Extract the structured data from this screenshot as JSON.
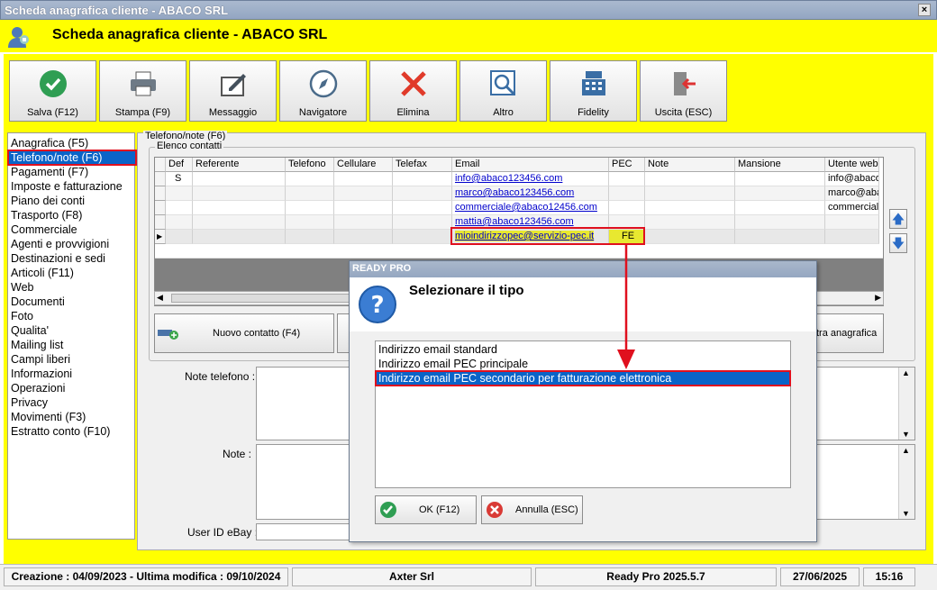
{
  "window": {
    "title": "Scheda anagrafica cliente - ABACO SRL",
    "close": "×"
  },
  "header": {
    "title": "Scheda anagrafica cliente - ABACO SRL"
  },
  "toolbar": [
    {
      "label": "Salva (F12)",
      "icon": "check-icon"
    },
    {
      "label": "Stampa (F9)",
      "icon": "printer-icon"
    },
    {
      "label": "Messaggio",
      "icon": "message-icon"
    },
    {
      "label": "Navigatore",
      "icon": "compass-icon"
    },
    {
      "label": "Elimina",
      "icon": "delete-icon"
    },
    {
      "label": "Altro",
      "icon": "search-doc-icon"
    },
    {
      "label": "Fidelity",
      "icon": "cash-register-icon"
    },
    {
      "label": "Uscita (ESC)",
      "icon": "exit-icon"
    }
  ],
  "sidebar": {
    "items": [
      "Anagrafica (F5)",
      "Telefono/note (F6)",
      "Pagamenti (F7)",
      "Imposte e fatturazione",
      "Piano dei conti",
      "Trasporto (F8)",
      "Commerciale",
      "Agenti e provvigioni",
      "Destinazioni e sedi",
      "Articoli (F11)",
      "Web",
      "Documenti",
      "Foto",
      "Qualita'",
      "Mailing list",
      "Campi liberi",
      "Informazioni",
      "Operazioni",
      "Privacy",
      "Movimenti (F3)",
      "Estratto conto (F10)"
    ],
    "selected": 1
  },
  "panel": {
    "title": "Telefono/note (F6)",
    "group": "Elenco contatti"
  },
  "grid": {
    "columns": [
      "Def",
      "Referente",
      "Telefono",
      "Cellulare",
      "Telefax",
      "Email",
      "PEC",
      "Note",
      "Mansione",
      "Utente web"
    ],
    "rows": [
      {
        "def": "S",
        "email": "info@abaco123456.com",
        "pec": "",
        "utente": "info@abaco1"
      },
      {
        "def": "",
        "email": "marco@abaco123456.com",
        "pec": "",
        "utente": "marco@abac"
      },
      {
        "def": "",
        "email": "commerciale@abaco12456.com",
        "pec": "",
        "utente": "commerciale("
      },
      {
        "def": "",
        "email": "mattia@abaco123456.com",
        "pec": "",
        "utente": ""
      },
      {
        "def": "",
        "email": "mioindirizzopec@servizio-pec.it",
        "pec": "FE",
        "utente": ""
      }
    ]
  },
  "buttons": {
    "new_contact": "Nuovo contatto (F4)",
    "other_registry": "tra anagrafica"
  },
  "fields": {
    "note_telefono": "Note telefono :",
    "note": "Note :",
    "ebay": "User ID eBay :"
  },
  "dialog": {
    "title": "READY PRO",
    "question": "Selezionare il tipo",
    "options": [
      "Indirizzo email standard",
      "Indirizzo email PEC principale",
      "Indirizzo email PEC secondario per fatturazione elettronica"
    ],
    "selected": 2,
    "ok": "OK (F12)",
    "cancel": "Annulla (ESC)"
  },
  "status": {
    "dates": "Creazione : 04/09/2023 - Ultima modifica : 09/10/2024",
    "company": "Axter Srl",
    "version": "Ready Pro 2025.5.7",
    "date": "27/06/2025",
    "time": "15:16"
  },
  "colors": {
    "accent_yellow": "#ffff00",
    "selection_blue": "#0a64c8",
    "highlight_red": "#e0101e"
  }
}
